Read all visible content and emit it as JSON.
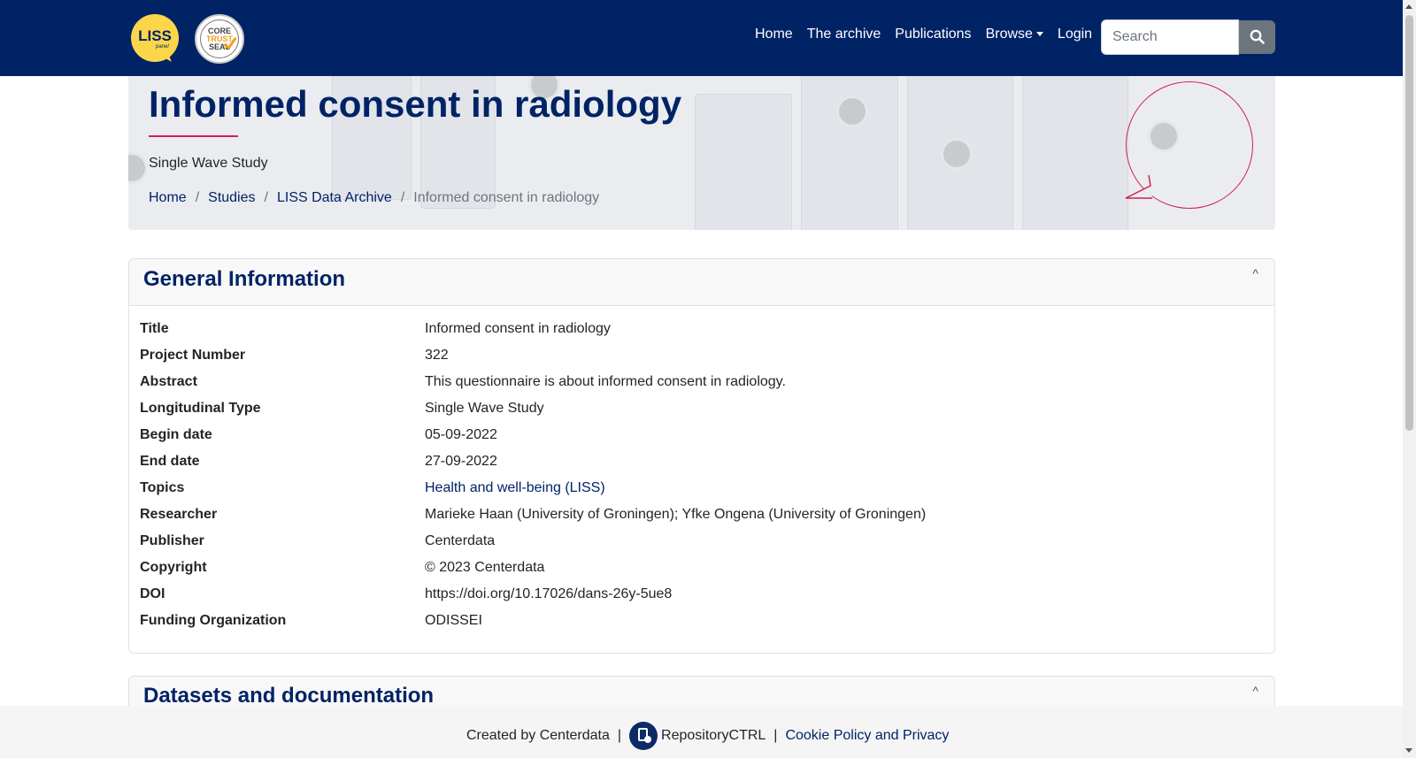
{
  "navbar": {
    "logo_text": "LISS",
    "logo_subtext": "panel",
    "seal_lines": [
      "CORE",
      "TRUST",
      "SEAL"
    ],
    "links": [
      {
        "label": "Home"
      },
      {
        "label": "The archive"
      },
      {
        "label": "Publications"
      },
      {
        "label": "Browse",
        "dropdown": true
      },
      {
        "label": "Login"
      }
    ],
    "search": {
      "placeholder": "Search",
      "value": ""
    },
    "icons": {
      "search": "search-icon",
      "browse_caret": "chevron-down-icon"
    }
  },
  "hero": {
    "title": "Informed consent in radiology",
    "subtitle": "Single Wave Study",
    "breadcrumb": [
      {
        "label": "Home"
      },
      {
        "label": "Studies"
      },
      {
        "label": "LISS Data Archive"
      },
      {
        "label": "Informed consent in radiology",
        "active": true
      }
    ],
    "breadcrumb_separator": "/"
  },
  "general_info": {
    "header": "General Information",
    "collapse_glyph": "^",
    "rows": [
      {
        "key": "Title",
        "value": "Informed consent in radiology"
      },
      {
        "key": "Project Number",
        "value": "322"
      },
      {
        "key": "Abstract",
        "value": "This questionnaire is about informed consent in radiology."
      },
      {
        "key": "Longitudinal Type",
        "value": "Single Wave Study"
      },
      {
        "key": "Begin date",
        "value": "05-09-2022"
      },
      {
        "key": "End date",
        "value": "27-09-2022"
      },
      {
        "key": "Topics",
        "value": "Health and well-being (LISS)",
        "link": true
      },
      {
        "key": "Researcher",
        "value": "Marieke Haan (University of Groningen); Yfke Ongena (University of Groningen)"
      },
      {
        "key": "Publisher",
        "value": "Centerdata"
      },
      {
        "key": "Copyright",
        "value": "© 2023 Centerdata"
      },
      {
        "key": "DOI",
        "value": "https://doi.org/10.17026/dans-26y-5ue8"
      },
      {
        "key": "Funding Organization",
        "value": "ODISSEI"
      }
    ]
  },
  "datasets": {
    "header": "Datasets and documentation",
    "collapse_glyph": "^"
  },
  "footer": {
    "created_by": "Created by Centerdata",
    "separator": "|",
    "product": "RepositoryCTRL",
    "cookie_link": "Cookie Policy and Privacy"
  },
  "colors": {
    "navbar_bg": "#002366",
    "accent_red": "#d0204e",
    "link": "#002366",
    "logo_yellow": "#fcd64a"
  }
}
